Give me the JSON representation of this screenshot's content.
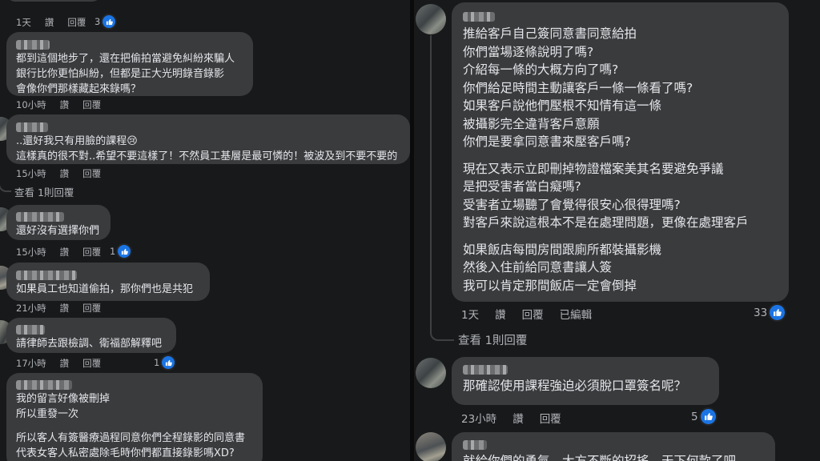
{
  "left": {
    "top_partial": {
      "time": "1天",
      "like": "讚",
      "reply": "回覆",
      "reactions": "3"
    },
    "comments": [
      {
        "lines": [
          "都到這個地步了，還在把偷拍當避免糾紛來騙人",
          "銀行比你更怕糾紛，但都是正大光明錄音錄影",
          "會像你們那樣藏起來錄嗎？"
        ],
        "time": "10小時",
        "like": "讚",
        "reply": "回覆"
      },
      {
        "lines": [
          "..還好我只有用臉的課程😢",
          "這樣真的很不對..希望不要這樣了！不然員工基層是最可憐的！被波及到不要不要的"
        ],
        "time": "15小時",
        "like": "讚",
        "reply": "回覆",
        "view_replies": "查看 1則回覆"
      },
      {
        "lines": [
          "還好沒有選擇你們"
        ],
        "time": "15小時",
        "like": "讚",
        "reply": "回覆",
        "reactions": "1"
      },
      {
        "lines": [
          "如果員工也知道偷拍，那你們也是共犯"
        ],
        "time": "21小時",
        "like": "讚",
        "reply": "回覆"
      },
      {
        "lines": [
          "請律師去跟檢調、衛福部解釋吧"
        ],
        "time": "17小時",
        "like": "讚",
        "reply": "回覆",
        "reactions": "1"
      },
      {
        "paragraphs": [
          [
            "我的留言好像被刪掉",
            "所以重發一次"
          ],
          [
            "所以客人有簽醫療過程同意你們全程錄影的同意書",
            "代表女客人私密處除毛時你們都直接錄影嗎XD?"
          ]
        ]
      }
    ]
  },
  "right": {
    "comments": [
      {
        "paragraphs": [
          [
            "推給客戶自己簽同意書同意給拍",
            "你們當場逐條說明了嗎?",
            "介紹每一條的大概方向了嗎?",
            "你們給足時間主動讓客戶一條一條看了嗎?",
            "如果客戶說他們壓根不知情有這一條",
            "被攝影完全違背客戶意願",
            "你們是要拿同意書來壓客戶嗎?"
          ],
          [
            "現在又表示立即刪掉物證檔案美其名要避免爭議",
            "是把受害者當白癡嗎?",
            "受害者立場聽了會覺得很安心很得理嗎?",
            "對客戶來說這根本不是在處理問題，更像在處理客戶"
          ],
          [
            "如果飯店每間房間跟廁所都裝攝影機",
            "然後入住前給同意書讓人簽",
            "我可以肯定那間飯店一定會倒掉"
          ]
        ],
        "time": "1天",
        "like": "讚",
        "reply": "回覆",
        "edited": "已編輯",
        "reactions": "33",
        "view_replies": "查看 1則回覆"
      },
      {
        "lines": [
          "那確認使用課程強迫必須脫口罩簽名呢？"
        ],
        "time": "23小時",
        "like": "讚",
        "reply": "回覆",
        "reactions": "5"
      },
      {
        "lines": [
          "就給你們的勇氣，大方不斷的招搖，天下何款了吧"
        ]
      }
    ]
  },
  "colors": {
    "background": "#18191a",
    "bubble": "#3a3b3c",
    "text": "#e4e6eb",
    "meta": "#b0b3b8",
    "like_blue": "#1b74e4"
  },
  "icons": {
    "like": "thumbs-up-icon"
  }
}
